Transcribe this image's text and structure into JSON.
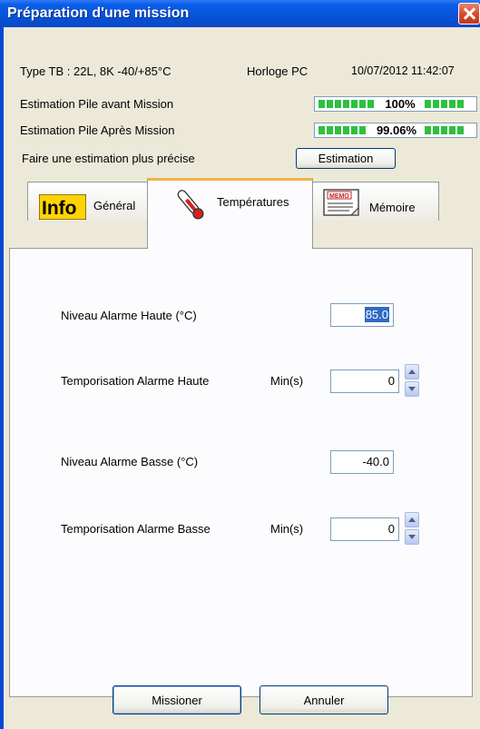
{
  "window": {
    "title": "Préparation d'une mission"
  },
  "header": {
    "type_tb": "Type TB :   22L, 8K -40/+85°C",
    "clock_label": "Horloge PC",
    "clock_value": "10/07/2012 11:42:07",
    "battery_before_label": "Estimation Pile avant Mission",
    "battery_before_value": "100%",
    "battery_before_fraction": 1.0,
    "battery_after_label": "Estimation Pile Après Mission",
    "battery_after_value": "99.06%",
    "battery_after_fraction": 0.9906,
    "battery_color": "#2ec040",
    "precise_label": "Faire une estimation plus précise",
    "estimation_button": "Estimation"
  },
  "tabs": [
    {
      "label": "Général",
      "icon": "info-icon",
      "active": false
    },
    {
      "label": "Températures",
      "icon": "thermometer-icon",
      "active": true
    },
    {
      "label": "Mémoire",
      "icon": "memo-icon",
      "active": false
    }
  ],
  "temperatures": {
    "high_level_label": "Niveau Alarme Haute (°C)",
    "high_level_value": "85.0",
    "high_delay_label": "Temporisation Alarme Haute",
    "high_delay_unit": "Min(s)",
    "high_delay_value": "0",
    "low_level_label": "Niveau Alarme Basse (°C)",
    "low_level_value": "-40.0",
    "low_delay_label": "Temporisation Alarme Basse",
    "low_delay_unit": "Min(s)",
    "low_delay_value": "0"
  },
  "footer": {
    "ok_button": "Missioner",
    "cancel_button": "Annuler"
  },
  "colors": {
    "accent": "#0a5ce8",
    "tab_highlight": "#f2b245",
    "selection": "#316ac5"
  }
}
